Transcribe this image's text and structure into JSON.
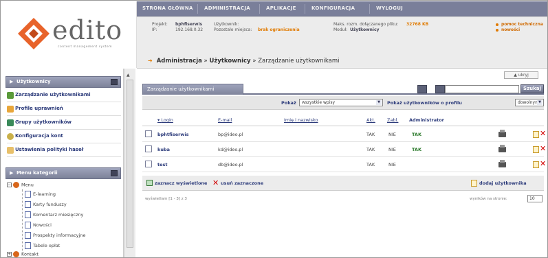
{
  "logo": {
    "word": "edito",
    "tagline": "content management system"
  },
  "topnav": [
    "STRONA GŁÓWNA",
    "ADMINISTRACJA",
    "APLIKACJE",
    "KONFIGURACJA",
    "WYLOGUJ"
  ],
  "info": {
    "projekt_label": "Projekt:",
    "projekt_value": "bphfiserwis",
    "ip_label": "IP:",
    "ip_value": "192.168.0.32",
    "uzytkownik_label": "Użytkownik:",
    "pozostalo_label": "Pozostało miejsca:",
    "pozostalo_value": "brak ograniczenia",
    "maks_label": "Maks. rozm. dołączanego pliku:",
    "maks_value": "32768 KB",
    "modul_label": "Moduł:",
    "modul_value": "Użytkownicy",
    "help_link": "pomoc techniczna",
    "news_link": "nowości"
  },
  "breadcrumb": {
    "part1": "Administracja",
    "sep": "»",
    "part2": "Użytkownicy",
    "part3": "Zarządzanie użytkownikami"
  },
  "sidebar": {
    "panel1_title": "Użytkownicy",
    "items": [
      "Zarządzanie użytkownikami",
      "Profile uprawnień",
      "Grupy użytkowników",
      "Konfiguracja kont",
      "Ustawienia polityki haseł"
    ],
    "panel2_title": "Menu kategorii",
    "tree": {
      "root": "Menu",
      "children": [
        "E-learning",
        "Karty funduszy",
        "Komentarz miesięczny",
        "Nowości",
        "Prospekty informacyjne",
        "Tabele opłat"
      ],
      "next": "Kontakt"
    }
  },
  "main": {
    "hide_label": "ukryj",
    "tab_title": "Zarządzanie użytkownikami",
    "search_button": "Szukaj",
    "filter": {
      "show_label": "Pokaż",
      "show_value": "wszystkie wpisy",
      "profile_label": "Pokaż użytkowników o profilu",
      "profile_value": "dowolnym"
    },
    "columns": [
      "Login",
      "E-mail",
      "Imię i nazwisko",
      "Akt.",
      "Zabl.",
      "Administrator"
    ],
    "rows": [
      {
        "login": "bphtfiserwis",
        "email": "bp@ideo.pl",
        "name": "",
        "akt": "TAK",
        "zabl": "NIE",
        "admin": "TAK"
      },
      {
        "login": "kuba",
        "email": "kd@ideo.pl",
        "name": "",
        "akt": "TAK",
        "zabl": "NIE",
        "admin": "TAK"
      },
      {
        "login": "test",
        "email": "db@ideo.pl",
        "name": "",
        "akt": "TAK",
        "zabl": "NIE",
        "admin": ""
      }
    ],
    "actions": {
      "select_label": "zaznacz wyświetlone",
      "delete_label": "usuń zaznaczone",
      "add_label": "dodaj użytkownika"
    },
    "footer": {
      "shown_label": "wyświetlam [1 - 3] z 3",
      "per_page_label": "wyników na stronie:",
      "per_page_value": "10"
    }
  },
  "colors": {
    "nav": "#7a7f9a",
    "accent": "#e07a00",
    "link": "#2b3a7a",
    "delete": "#d10000"
  }
}
